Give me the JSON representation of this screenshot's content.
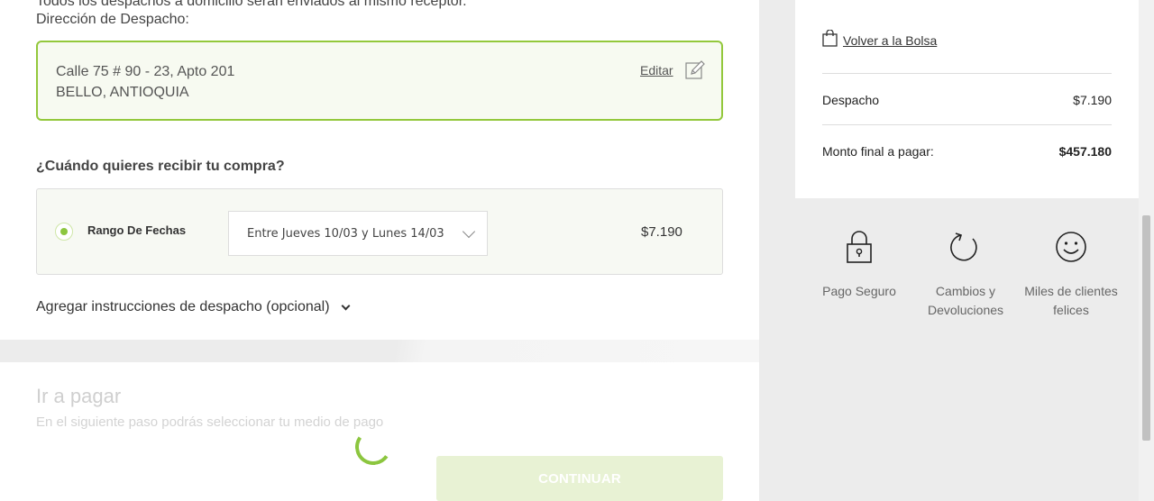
{
  "shipping": {
    "top_cut_text": "Todos los despachos a domicilio serán enviados al mismo receptor.",
    "address_label": "Dirección de Despacho:",
    "address_line1": "Calle 75 # 90 - 23, Apto 201",
    "address_line2": "BELLO, ANTIOQUIA",
    "edit_label": "Editar",
    "when_title": "¿Cuándo quieres recibir tu compra?",
    "option": {
      "label": "Rango De Fechas",
      "selected": true,
      "date_value": "Entre Jueves 10/03 y Lunes 14/03",
      "price": "$7.190"
    },
    "instructions_label": "Agregar instrucciones de despacho (opcional)"
  },
  "payment": {
    "title": "Ir a pagar",
    "subtitle": "En el siguiente paso podrás seleccionar tu medio de pago",
    "continue_label": "CONTINUAR"
  },
  "summary": {
    "back_label": "Volver a la Bolsa",
    "shipping_label": "Despacho",
    "shipping_value": "$7.190",
    "total_label": "Monto final a pagar:",
    "total_value": "$457.180"
  },
  "trust": [
    {
      "icon": "lock-icon",
      "label": "Pago Seguro"
    },
    {
      "icon": "refresh-icon",
      "label": "Cambios y Devoluciones"
    },
    {
      "icon": "smiley-icon",
      "label": "Miles de clientes felices"
    }
  ],
  "colors": {
    "accent": "#8cc63f",
    "border_accent": "#93c83c",
    "disabled_button": "#e8f2d4"
  }
}
